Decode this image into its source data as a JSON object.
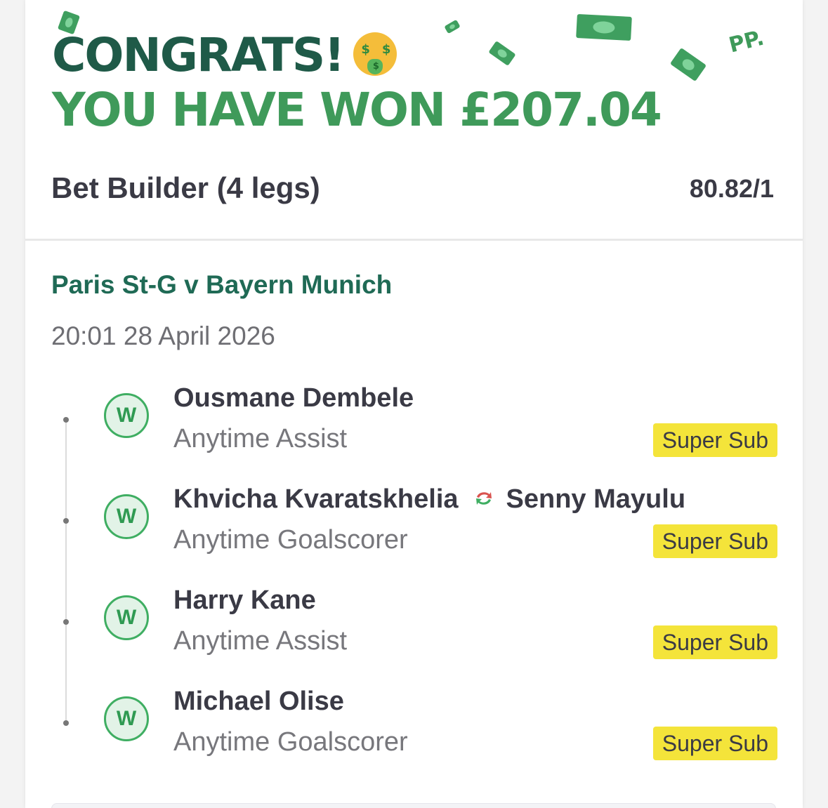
{
  "header": {
    "congrats": "CONGRATS!",
    "win_text": "YOU HAVE WON £207.04",
    "brand_mark": "PP."
  },
  "bet": {
    "type": "Bet Builder (4 legs)",
    "odds": "80.82/1"
  },
  "event": {
    "name": "Paris St-G v Bayern Munich",
    "datetime": "20:01 28 April 2026"
  },
  "legs": [
    {
      "result": "W",
      "player": "Ousmane Dembele",
      "sub_in": "",
      "market": "Anytime Assist",
      "tag": "Super Sub"
    },
    {
      "result": "W",
      "player": "Khvicha Kvaratskhelia",
      "sub_in": "Senny Mayulu",
      "market": "Anytime Goalscorer",
      "tag": "Super Sub"
    },
    {
      "result": "W",
      "player": "Harry Kane",
      "sub_in": "",
      "market": "Anytime Assist",
      "tag": "Super Sub"
    },
    {
      "result": "W",
      "player": "Michael Olise",
      "sub_in": "",
      "market": "Anytime Goalscorer",
      "tag": "Super Sub"
    }
  ],
  "colors": {
    "brand_dark_green": "#1f5a48",
    "brand_green": "#3f9a5a",
    "win_badge": "#3fae62",
    "super_sub_yellow": "#f4e43a",
    "text_dark": "#3a3a45"
  },
  "icons": {
    "emoji": "money-mouth-face-icon",
    "swap": "substitution-swap-icon",
    "decor": "money-bill-icon"
  }
}
